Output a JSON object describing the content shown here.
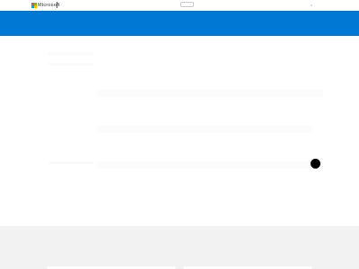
{
  "header": {
    "brand_name": "Microsoft",
    "logo_icon": "microsoft-logo-icon",
    "logo_colors": [
      "#f25022",
      "#7fba00",
      "#00a4ef",
      "#ffb900"
    ]
  },
  "banner": {
    "color": "#0078d4"
  },
  "footer": {
    "color": "#f2f2f2"
  },
  "pointer": {
    "icon": "cursor-dot-icon",
    "color": "#000000"
  }
}
